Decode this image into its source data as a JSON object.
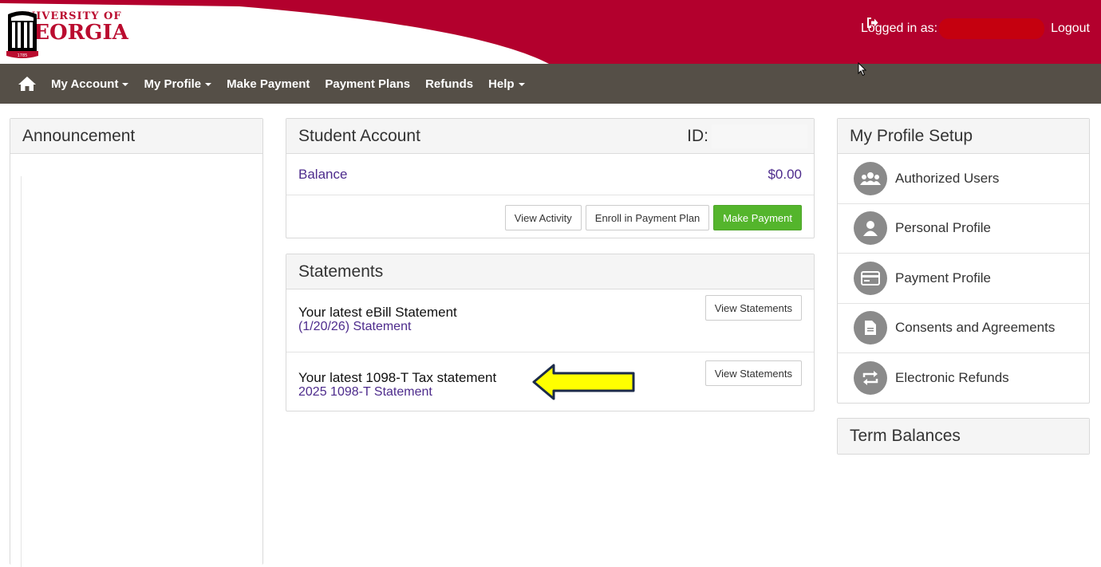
{
  "header": {
    "logo_line1": "UNIVERSITY OF",
    "logo_line2": "GEORGIA",
    "logo_year": "1785",
    "logged_in_label": "Logged in as:",
    "logout_label": "Logout",
    "brand_color": "#ba0c2f"
  },
  "nav": {
    "home_icon": "home-icon",
    "items": [
      {
        "label": "My Account",
        "dropdown": true
      },
      {
        "label": "My Profile",
        "dropdown": true
      },
      {
        "label": "Make Payment",
        "dropdown": false
      },
      {
        "label": "Payment Plans",
        "dropdown": false
      },
      {
        "label": "Refunds",
        "dropdown": false
      },
      {
        "label": "Help",
        "dropdown": true
      }
    ]
  },
  "announcement": {
    "title": "Announcement"
  },
  "student_account": {
    "title": "Student Account",
    "id_label": "ID:",
    "balance_label": "Balance",
    "balance_value": "$0.00",
    "buttons": {
      "view_activity": "View Activity",
      "enroll": "Enroll in Payment Plan",
      "make_payment": "Make Payment"
    }
  },
  "statements": {
    "title": "Statements",
    "rows": [
      {
        "title": "Your latest eBill Statement",
        "link": "(1/20/26) Statement",
        "button": "View Statements"
      },
      {
        "title": "Your latest 1098-T Tax statement",
        "link": "2025 1098-T Statement",
        "button": "View Statements"
      }
    ]
  },
  "profile_setup": {
    "title": "My Profile Setup",
    "items": [
      {
        "label": "Authorized Users",
        "icon": "users-icon"
      },
      {
        "label": "Personal Profile",
        "icon": "person-icon"
      },
      {
        "label": "Payment Profile",
        "icon": "credit-card-icon"
      },
      {
        "label": "Consents and Agreements",
        "icon": "document-icon"
      },
      {
        "label": "Electronic Refunds",
        "icon": "refresh-arrows-icon"
      }
    ]
  },
  "term_balances": {
    "title": "Term Balances"
  },
  "colors": {
    "nav_bg": "#554f47",
    "link_purple": "#4d2b8c",
    "green_button": "#54b52c",
    "annotation_arrow": "#ffff00"
  }
}
